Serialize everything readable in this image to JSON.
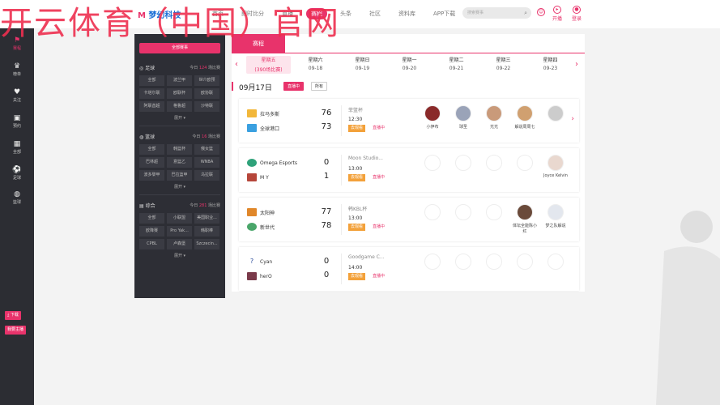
{
  "watermark": "开云体育（中国）官网",
  "logo": {
    "text_a": "M",
    "text_b": "梦幻科技"
  },
  "nav": [
    "首页",
    "即时比分",
    "直播",
    "赛程",
    "头条",
    "社区",
    "资料库",
    "APP下载"
  ],
  "nav_active": 3,
  "search": {
    "placeholder": "搜索赛事"
  },
  "header_icons": [
    {
      "label": "开播"
    },
    {
      "label": "登录"
    }
  ],
  "sidebar": {
    "items": [
      {
        "label": "赛程",
        "icon": "calendar-flag-icon"
      },
      {
        "label": "榜单",
        "icon": "trophy-icon"
      },
      {
        "label": "关注",
        "icon": "heart-icon"
      },
      {
        "label": "预约",
        "icon": "clock-icon"
      },
      {
        "label": "全部",
        "icon": "grid-icon"
      },
      {
        "label": "足球",
        "icon": "football-icon"
      },
      {
        "label": "篮球",
        "icon": "basketball-icon"
      }
    ],
    "download_label": "下载",
    "apply_label": "我要主播"
  },
  "filter": {
    "all_label": "全部赛事",
    "sections": [
      {
        "title": "足球",
        "count_prefix": "今日",
        "count": "124",
        "count_suffix": "场比赛",
        "items": [
          "全部",
          "波兰甲",
          "世介欧预",
          "卡塔尔联",
          "欧联杯",
          "欧协联",
          "阿联酋超",
          "格鲁超",
          "沙特联"
        ],
        "expand": "展开"
      },
      {
        "title": "篮球",
        "count_prefix": "今日",
        "count": "16",
        "count_suffix": "场比赛",
        "items": [
          "全部",
          "韩篮杯",
          "俄女篮",
          "巴林超",
          "意篮乙",
          "WNBA",
          "波多黎甲",
          "巴拉篮甲",
          "乌拉联"
        ],
        "expand": "展开"
      },
      {
        "title": "综合",
        "count_prefix": "今日",
        "count": "281",
        "count_suffix": "场比赛",
        "items": [
          "全部",
          "小联盟",
          "美国职业...",
          "欧降赛",
          "Pro Yak...",
          "韩职棒",
          "CPBL",
          "卢森堡",
          "Szczecin..."
        ],
        "expand": "展开"
      }
    ]
  },
  "schedule": {
    "tab": "赛程",
    "days": [
      {
        "w": "星期五",
        "d": "(390场比赛)"
      },
      {
        "w": "星期六",
        "d": "09-18"
      },
      {
        "w": "星期日",
        "d": "09-19"
      },
      {
        "w": "星期一",
        "d": "09-20"
      },
      {
        "w": "星期二",
        "d": "09-21"
      },
      {
        "w": "星期三",
        "d": "09-22"
      },
      {
        "w": "星期四",
        "d": "09-23"
      }
    ],
    "date": "09月17日",
    "chip_live": "直播中",
    "chip_all": "所有",
    "matches": [
      {
        "home": "拉马多斯",
        "away": "全球港口",
        "hs": "76",
        "as": "73",
        "league": "菲篮杯",
        "time": "12:30",
        "btn": "去观看",
        "status": "直播中",
        "anchors": [
          "小伊布",
          "球圣",
          "光光",
          "解说周周七",
          ""
        ]
      },
      {
        "home": "Omega Esports",
        "away": "M Y",
        "hs": "0",
        "as": "1",
        "league": "Moon Studio...",
        "time": "13:00",
        "btn": "去观看",
        "status": "直播中",
        "anchors": [
          "",
          "",
          "",
          "",
          "Joyce Kelvin"
        ]
      },
      {
        "home": "太阳神",
        "away": "新世代",
        "hs": "77",
        "as": "78",
        "league": "韩KBL杯",
        "time": "13:00",
        "btn": "去观看",
        "status": "直播中",
        "anchors": [
          "",
          "",
          "",
          "体坛全能陈小红",
          "梦之队解说"
        ]
      },
      {
        "home": "Cyan",
        "away": "herO",
        "hs": "0",
        "as": "0",
        "league": "Goodgame C...",
        "time": "14:00",
        "btn": "去观看",
        "status": "直播中",
        "anchors": [
          "",
          "",
          "",
          "",
          ""
        ]
      }
    ]
  },
  "colors": {
    "accent": "#e8336b",
    "dark": "#2c2d33"
  }
}
